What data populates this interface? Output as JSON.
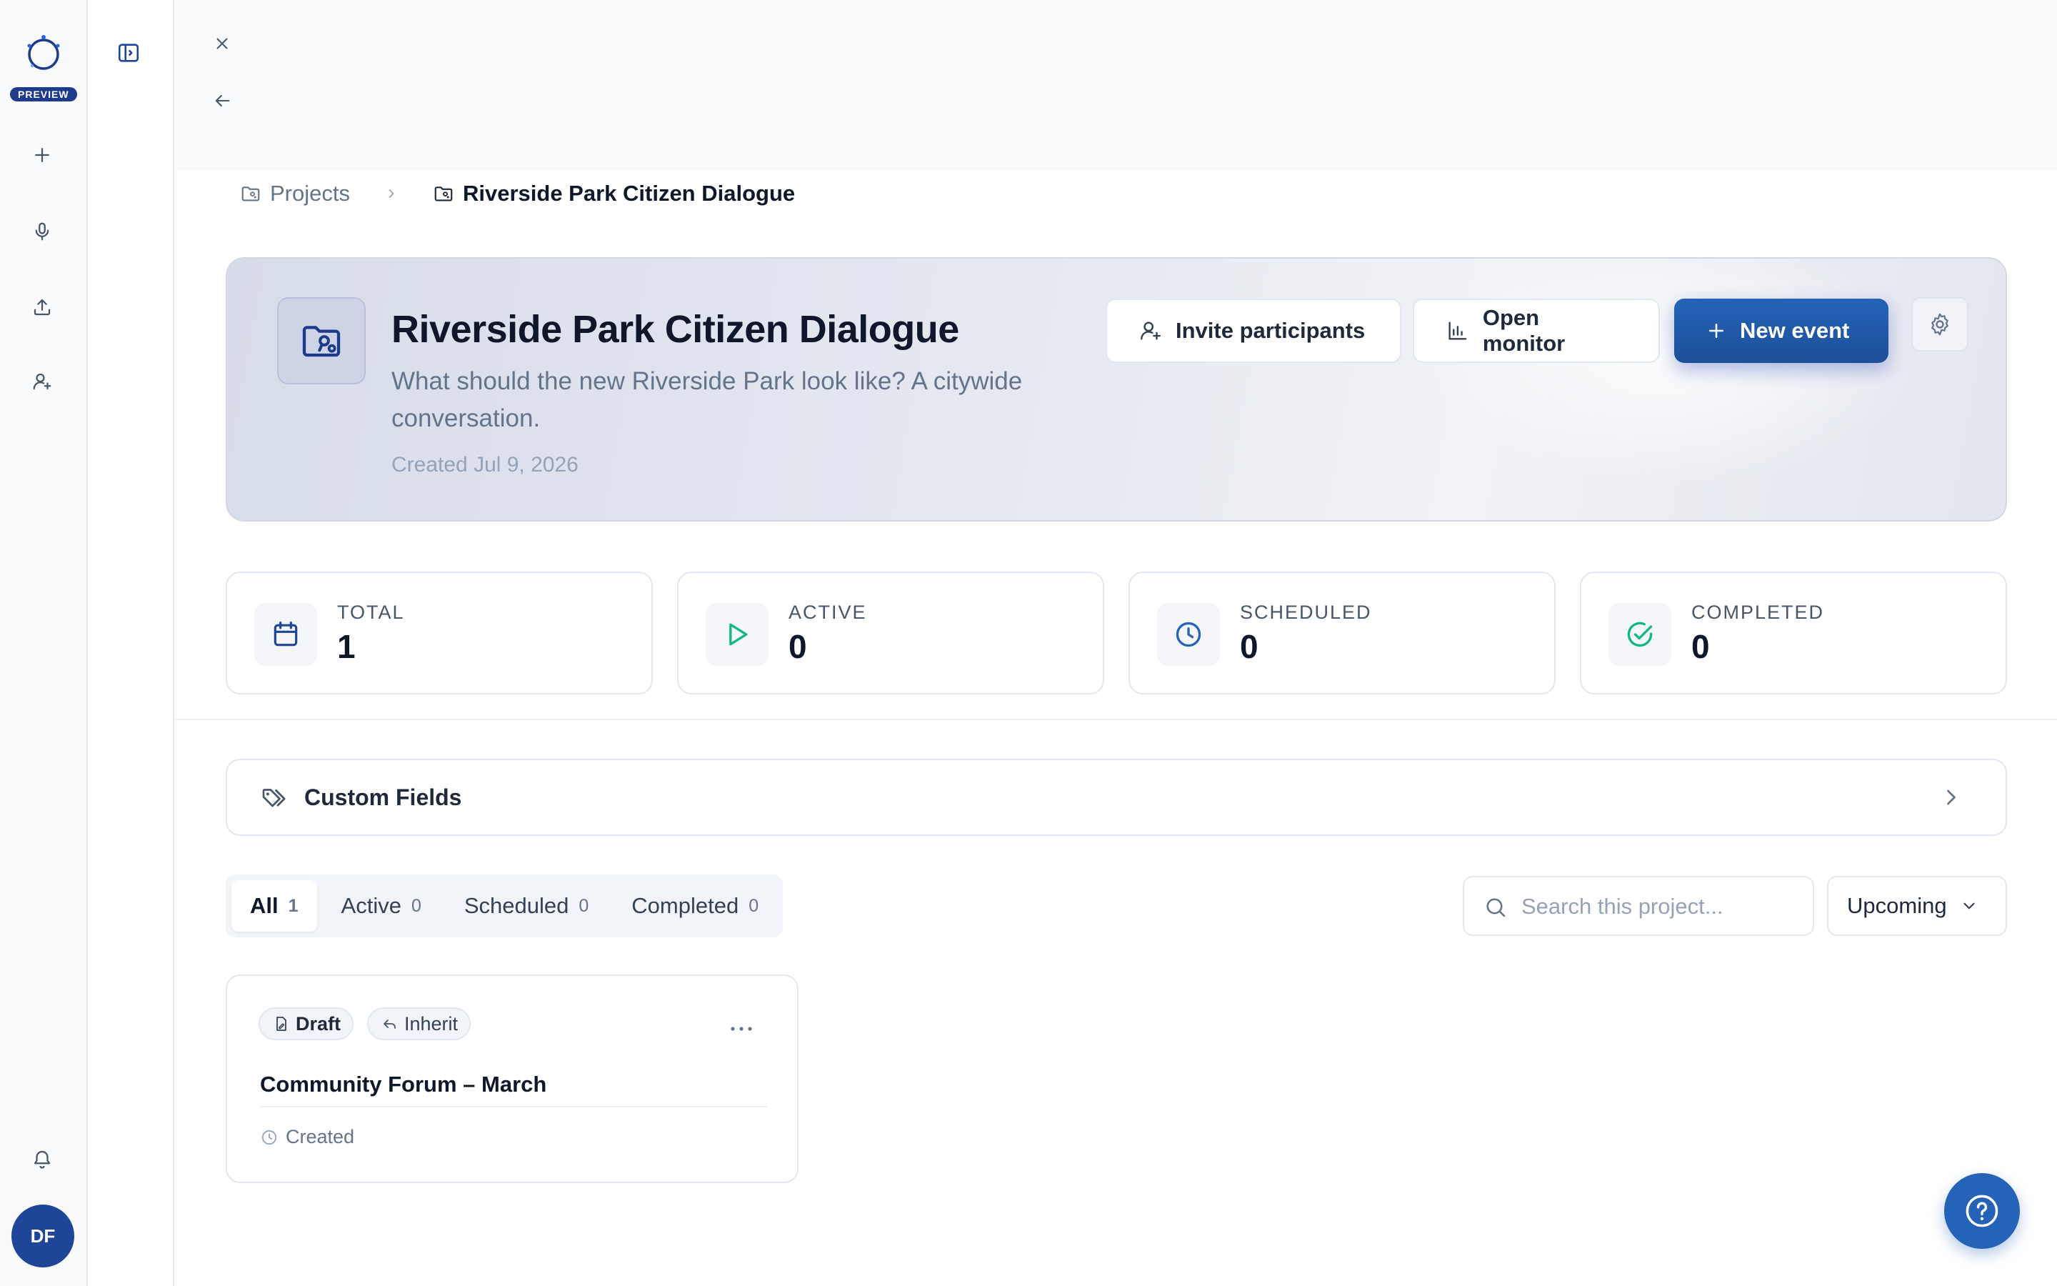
{
  "app": {
    "badge": "PREVIEW",
    "user_initials": "DF",
    "accent": "#1e4597"
  },
  "rail_icons": [
    "plus-icon",
    "microphone-icon",
    "upload-icon",
    "user-plus-icon",
    "bell-icon"
  ],
  "breadcrumb": {
    "root": "Projects",
    "current": "Riverside Park Citizen Dialogue"
  },
  "project": {
    "title": "Riverside Park Citizen Dialogue",
    "description": "What should the new Riverside Park look like? A citywide conversation.",
    "created": "Created Jul 9, 2026"
  },
  "actions": {
    "invite": "Invite participants",
    "monitor": "Open monitor",
    "new_event": "New event"
  },
  "stats": [
    {
      "label": "TOTAL",
      "value": "1",
      "icon": "calendar-icon",
      "color": "#1e4597"
    },
    {
      "label": "ACTIVE",
      "value": "0",
      "icon": "play-icon",
      "color": "#10b981"
    },
    {
      "label": "SCHEDULED",
      "value": "0",
      "icon": "clock-icon",
      "color": "#2563b8"
    },
    {
      "label": "COMPLETED",
      "value": "0",
      "icon": "check-circle-icon",
      "color": "#10b981"
    }
  ],
  "custom_fields": {
    "label": "Custom Fields"
  },
  "tabs": [
    {
      "label": "All",
      "count": "1",
      "active": true
    },
    {
      "label": "Active",
      "count": "0",
      "active": false
    },
    {
      "label": "Scheduled",
      "count": "0",
      "active": false
    },
    {
      "label": "Completed",
      "count": "0",
      "active": false
    }
  ],
  "search": {
    "placeholder": "Search this project...",
    "value": ""
  },
  "sort": {
    "selected": "Upcoming"
  },
  "events": [
    {
      "status": "Draft",
      "mode": "Inherit",
      "title": "Community Forum – March",
      "meta": "Created"
    }
  ]
}
